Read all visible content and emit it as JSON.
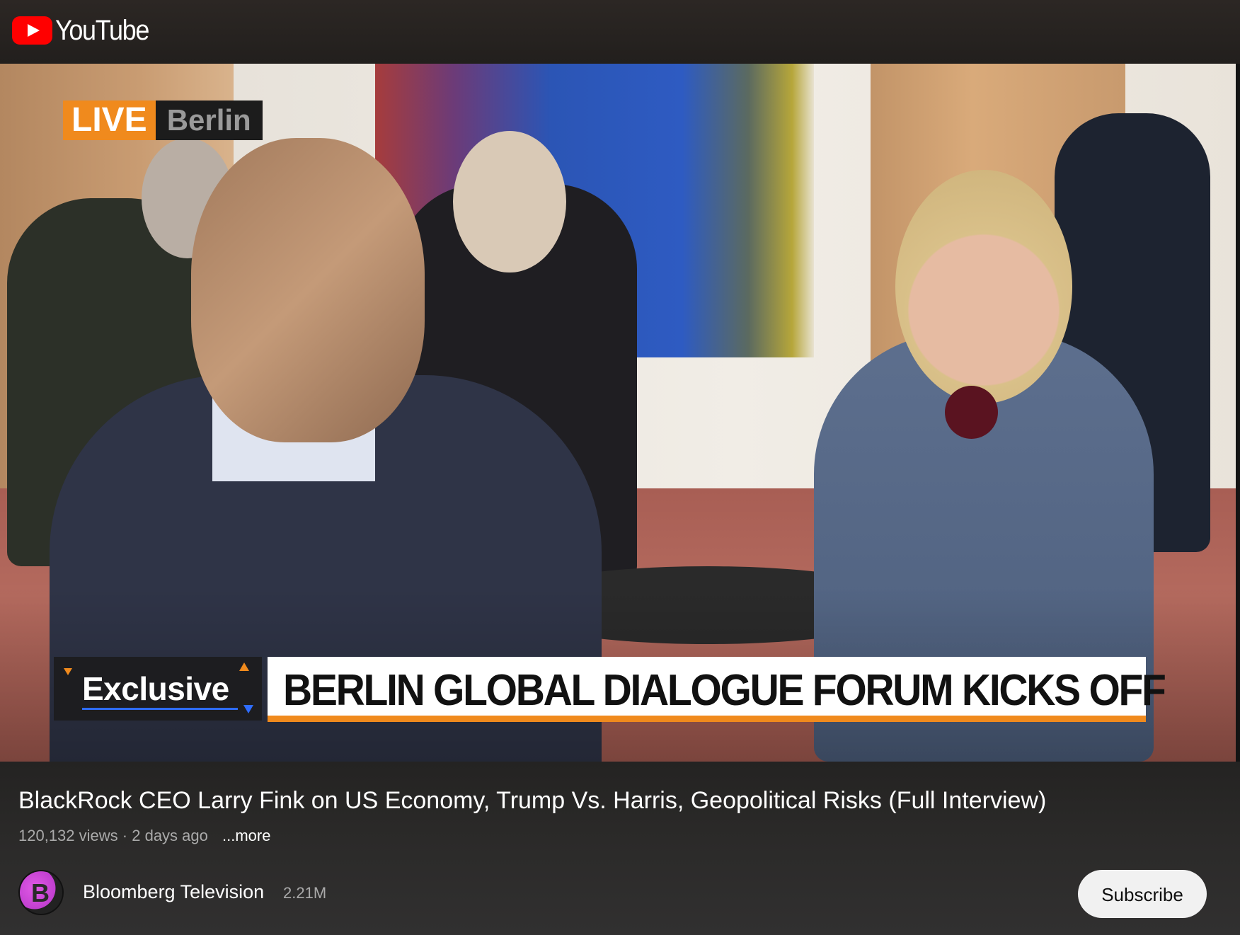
{
  "app": {
    "logo_text": "YouTube",
    "logo_icon": "youtube-play-icon"
  },
  "video": {
    "live_label": "LIVE",
    "location": "Berlin",
    "exclusive_label": "Exclusive",
    "headline": "BERLIN GLOBAL DIALOGUE FORUM KICKS OFF",
    "accent_color": "#f08a1d",
    "secondary_accent": "#2e6cff"
  },
  "info": {
    "title": "BlackRock CEO Larry Fink on US Economy, Trump Vs. Harris, Geopolitical Risks (Full Interview)",
    "views": "120,132 views",
    "separator": "·",
    "age": "2 days ago",
    "more_label": "...more"
  },
  "channel": {
    "avatar_letter": "B",
    "name": "Bloomberg Television",
    "subscribers": "2.21M",
    "subscribe_label": "Subscribe"
  }
}
